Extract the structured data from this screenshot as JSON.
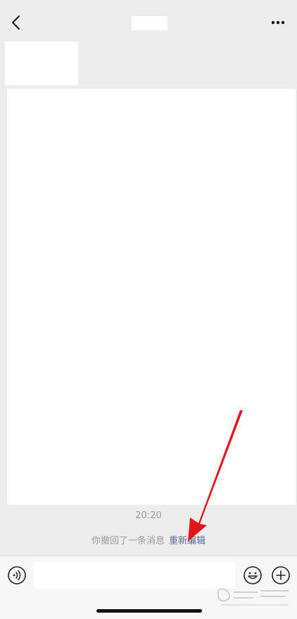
{
  "chat": {
    "time": "20:20",
    "recall_text": "你撤回了一条消息",
    "reedit_label": "重新编辑"
  },
  "colors": {
    "background": "#ededed",
    "link": "#576b95",
    "arrow": "#e5151b"
  },
  "icons": {
    "back": "chevron-left-icon",
    "more": "more-dots-icon",
    "voice": "voice-icon",
    "emoji": "emoji-icon",
    "plus": "plus-icon"
  }
}
